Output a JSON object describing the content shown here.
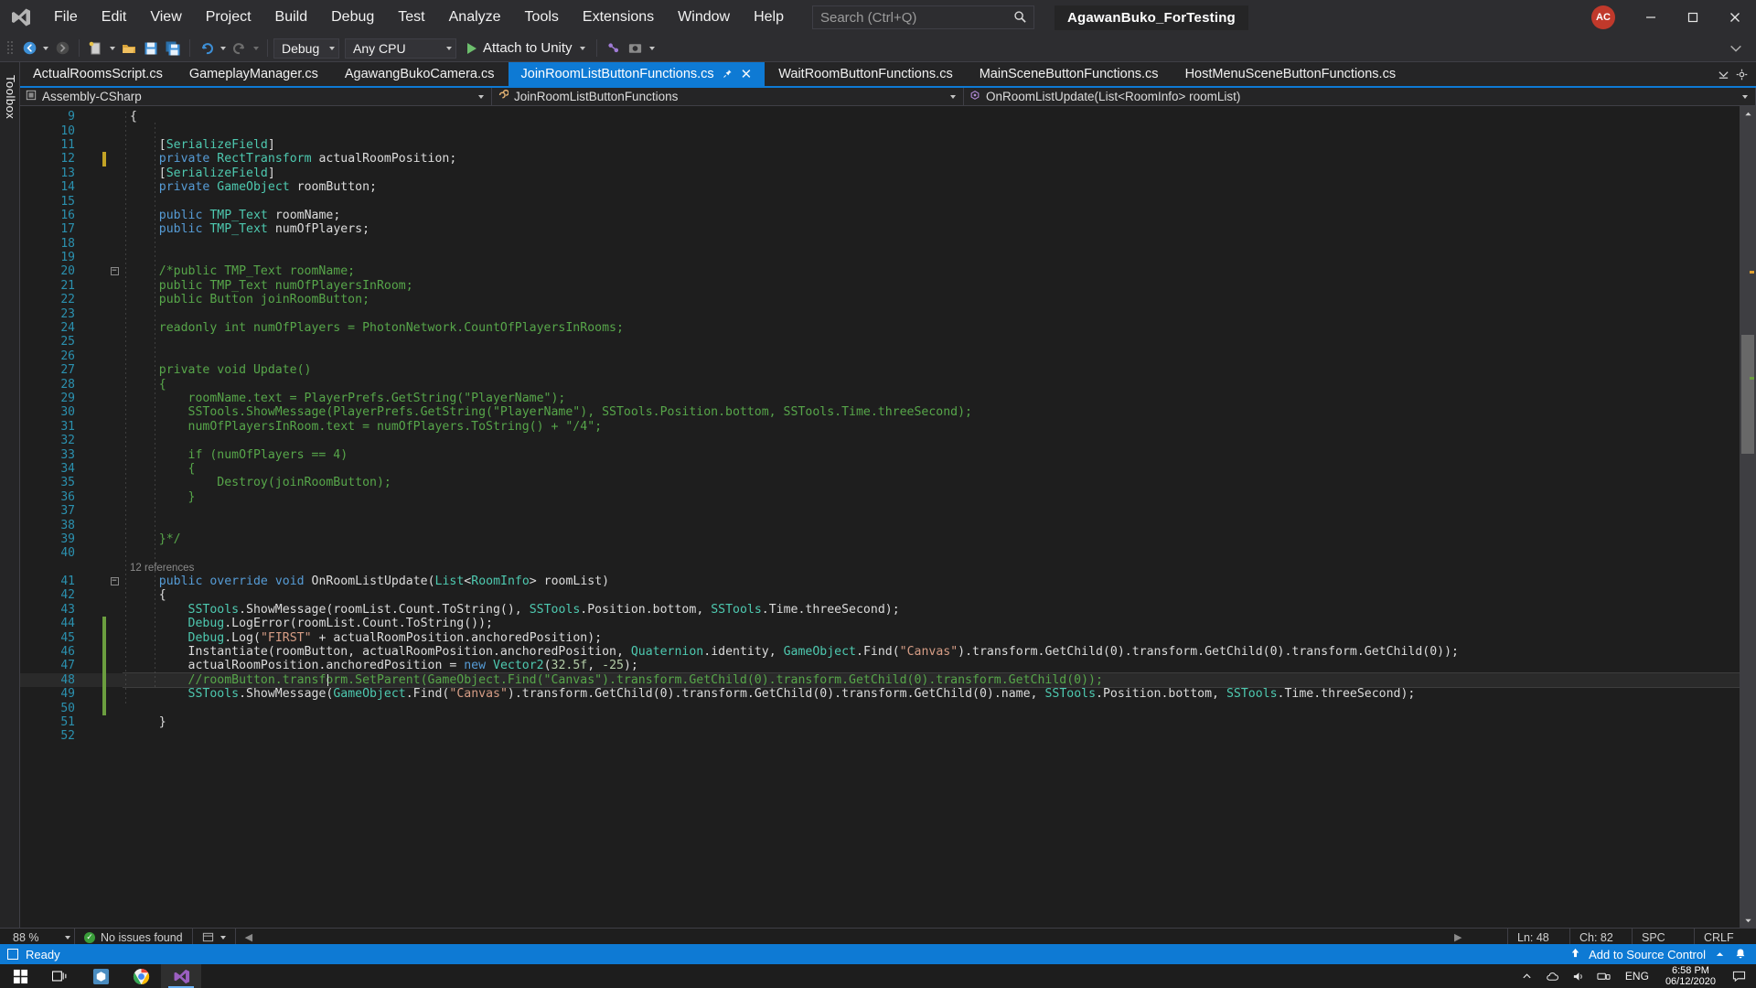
{
  "titlebar": {
    "logo": "visual-studio-logo",
    "menus": [
      "File",
      "Edit",
      "View",
      "Project",
      "Build",
      "Debug",
      "Test",
      "Analyze",
      "Tools",
      "Extensions",
      "Window",
      "Help"
    ],
    "search_placeholder": "Search (Ctrl+Q)",
    "solution_name": "AgawanBuko_ForTesting",
    "user_initials": "AC",
    "minimize": "─",
    "maximize": "☐",
    "close": "✕"
  },
  "toolbar": {
    "nav_back": "back-arrow",
    "nav_forward": "forward-arrow",
    "new_item": "new-item",
    "open_file": "open-file",
    "save": "save",
    "save_all": "save-all",
    "undo": "undo",
    "redo": "redo",
    "config": "Debug",
    "platform": "Any CPU",
    "run_label": "Attach to Unity"
  },
  "toolbox": {
    "label": "Toolbox"
  },
  "tabs": {
    "items": [
      {
        "label": "ActualRoomsScript.cs",
        "active": false
      },
      {
        "label": "GameplayManager.cs",
        "active": false
      },
      {
        "label": "AgawangBukoCamera.cs",
        "active": false
      },
      {
        "label": "JoinRoomListButtonFunctions.cs",
        "active": true
      },
      {
        "label": "WaitRoomButtonFunctions.cs",
        "active": false
      },
      {
        "label": "MainSceneButtonFunctions.cs",
        "active": false
      },
      {
        "label": "HostMenuSceneButtonFunctions.cs",
        "active": false
      }
    ],
    "pin_icon": "pin-icon",
    "close_icon": "close-icon",
    "overflow_icon": "chevron-down-icon",
    "settings_icon": "gear-icon"
  },
  "navbar": {
    "project": "Assembly-CSharp",
    "type": "JoinRoomListButtonFunctions",
    "member": "OnRoomListUpdate(List<RoomInfo> roomList)"
  },
  "editor": {
    "first_line": 9,
    "lines": [
      {
        "n": 9,
        "change": "",
        "fold": "",
        "indent": 1,
        "tokens": [
          [
            "p",
            "{"
          ]
        ]
      },
      {
        "n": 10,
        "change": "",
        "fold": "",
        "indent": 1,
        "tokens": []
      },
      {
        "n": 11,
        "change": "",
        "fold": "",
        "indent": 2,
        "tokens": [
          [
            "p",
            "    ["
          ],
          [
            "atr",
            "SerializeField"
          ],
          [
            "p",
            "]"
          ]
        ]
      },
      {
        "n": 12,
        "change": "yellow",
        "fold": "",
        "indent": 2,
        "tokens": [
          [
            "p",
            "    "
          ],
          [
            "k",
            "private"
          ],
          [
            "p",
            " "
          ],
          [
            "t",
            "RectTransform"
          ],
          [
            "p",
            " actualRoomPosition;"
          ]
        ]
      },
      {
        "n": 13,
        "change": "",
        "fold": "",
        "indent": 2,
        "tokens": [
          [
            "p",
            "    ["
          ],
          [
            "atr",
            "SerializeField"
          ],
          [
            "p",
            "]"
          ]
        ]
      },
      {
        "n": 14,
        "change": "",
        "fold": "",
        "indent": 2,
        "tokens": [
          [
            "p",
            "    "
          ],
          [
            "k",
            "private"
          ],
          [
            "p",
            " "
          ],
          [
            "t",
            "GameObject"
          ],
          [
            "p",
            " roomButton;"
          ]
        ]
      },
      {
        "n": 15,
        "change": "",
        "fold": "",
        "indent": 2,
        "tokens": []
      },
      {
        "n": 16,
        "change": "",
        "fold": "",
        "indent": 2,
        "tokens": [
          [
            "p",
            "    "
          ],
          [
            "k",
            "public"
          ],
          [
            "p",
            " "
          ],
          [
            "t",
            "TMP_Text"
          ],
          [
            "p",
            " roomName;"
          ]
        ]
      },
      {
        "n": 17,
        "change": "",
        "fold": "",
        "indent": 2,
        "tokens": [
          [
            "p",
            "    "
          ],
          [
            "k",
            "public"
          ],
          [
            "p",
            " "
          ],
          [
            "t",
            "TMP_Text"
          ],
          [
            "p",
            " numOfPlayers;"
          ]
        ]
      },
      {
        "n": 18,
        "change": "",
        "fold": "",
        "indent": 2,
        "tokens": []
      },
      {
        "n": 19,
        "change": "",
        "fold": "",
        "indent": 2,
        "tokens": []
      },
      {
        "n": 20,
        "change": "",
        "fold": "minus",
        "indent": 2,
        "tokens": [
          [
            "c",
            "    /*public TMP_Text roomName;"
          ]
        ]
      },
      {
        "n": 21,
        "change": "",
        "fold": "",
        "indent": 2,
        "tokens": [
          [
            "c",
            "    public TMP_Text numOfPlayersInRoom;"
          ]
        ]
      },
      {
        "n": 22,
        "change": "",
        "fold": "",
        "indent": 2,
        "tokens": [
          [
            "c",
            "    public Button joinRoomButton;"
          ]
        ]
      },
      {
        "n": 23,
        "change": "",
        "fold": "",
        "indent": 2,
        "tokens": []
      },
      {
        "n": 24,
        "change": "",
        "fold": "",
        "indent": 2,
        "tokens": [
          [
            "c",
            "    readonly int numOfPlayers = PhotonNetwork.CountOfPlayersInRooms;"
          ]
        ]
      },
      {
        "n": 25,
        "change": "",
        "fold": "",
        "indent": 2,
        "tokens": []
      },
      {
        "n": 26,
        "change": "",
        "fold": "",
        "indent": 2,
        "tokens": []
      },
      {
        "n": 27,
        "change": "",
        "fold": "",
        "indent": 2,
        "tokens": [
          [
            "c",
            "    private void Update()"
          ]
        ]
      },
      {
        "n": 28,
        "change": "",
        "fold": "",
        "indent": 2,
        "tokens": [
          [
            "c",
            "    {"
          ]
        ]
      },
      {
        "n": 29,
        "change": "",
        "fold": "",
        "indent": 3,
        "tokens": [
          [
            "c",
            "        roomName.text = PlayerPrefs.GetString(\"PlayerName\");"
          ]
        ]
      },
      {
        "n": 30,
        "change": "",
        "fold": "",
        "indent": 3,
        "tokens": [
          [
            "c",
            "        SSTools.ShowMessage(PlayerPrefs.GetString(\"PlayerName\"), SSTools.Position.bottom, SSTools.Time.threeSecond);"
          ]
        ]
      },
      {
        "n": 31,
        "change": "",
        "fold": "",
        "indent": 3,
        "tokens": [
          [
            "c",
            "        numOfPlayersInRoom.text = numOfPlayers.ToString() + \"/4\";"
          ]
        ]
      },
      {
        "n": 32,
        "change": "",
        "fold": "",
        "indent": 3,
        "tokens": []
      },
      {
        "n": 33,
        "change": "",
        "fold": "",
        "indent": 3,
        "tokens": [
          [
            "c",
            "        if (numOfPlayers == 4)"
          ]
        ]
      },
      {
        "n": 34,
        "change": "",
        "fold": "",
        "indent": 3,
        "tokens": [
          [
            "c",
            "        {"
          ]
        ]
      },
      {
        "n": 35,
        "change": "",
        "fold": "",
        "indent": 4,
        "tokens": [
          [
            "c",
            "            Destroy(joinRoomButton);"
          ]
        ]
      },
      {
        "n": 36,
        "change": "",
        "fold": "",
        "indent": 3,
        "tokens": [
          [
            "c",
            "        }"
          ]
        ]
      },
      {
        "n": 37,
        "change": "",
        "fold": "",
        "indent": 2,
        "tokens": []
      },
      {
        "n": 38,
        "change": "",
        "fold": "",
        "indent": 2,
        "tokens": []
      },
      {
        "n": 39,
        "change": "",
        "fold": "",
        "indent": 2,
        "tokens": [
          [
            "c",
            "    }*/"
          ]
        ]
      },
      {
        "n": 40,
        "change": "",
        "fold": "",
        "indent": 2,
        "tokens": []
      },
      {
        "n": "",
        "change": "",
        "fold": "",
        "indent": 2,
        "refs": "12 references",
        "tokens": []
      },
      {
        "n": 41,
        "change": "",
        "fold": "minus",
        "indent": 2,
        "tokens": [
          [
            "p",
            "    "
          ],
          [
            "k",
            "public"
          ],
          [
            "p",
            " "
          ],
          [
            "k",
            "override"
          ],
          [
            "p",
            " "
          ],
          [
            "k",
            "void"
          ],
          [
            "p",
            " OnRoomListUpdate("
          ],
          [
            "t",
            "List"
          ],
          [
            "p",
            "<"
          ],
          [
            "t",
            "RoomInfo"
          ],
          [
            "p",
            "> roomList)"
          ]
        ]
      },
      {
        "n": 42,
        "change": "",
        "fold": "",
        "indent": 2,
        "tokens": [
          [
            "p",
            "    {"
          ]
        ]
      },
      {
        "n": 43,
        "change": "",
        "fold": "",
        "indent": 3,
        "tokens": [
          [
            "p",
            "        "
          ],
          [
            "t",
            "SSTools"
          ],
          [
            "p",
            ".ShowMessage(roomList.Count.ToString(), "
          ],
          [
            "t",
            "SSTools"
          ],
          [
            "p",
            ".Position.bottom, "
          ],
          [
            "t",
            "SSTools"
          ],
          [
            "p",
            ".Time.threeSecond);"
          ]
        ]
      },
      {
        "n": 44,
        "change": "green",
        "fold": "",
        "indent": 3,
        "tokens": [
          [
            "p",
            "        "
          ],
          [
            "t",
            "Debug"
          ],
          [
            "p",
            ".LogError(roomList.Count.ToString());"
          ]
        ]
      },
      {
        "n": 45,
        "change": "green",
        "fold": "",
        "indent": 3,
        "tokens": [
          [
            "p",
            "        "
          ],
          [
            "t",
            "Debug"
          ],
          [
            "p",
            ".Log("
          ],
          [
            "s",
            "\"FIRST\""
          ],
          [
            "p",
            " + actualRoomPosition.anchoredPosition);"
          ]
        ]
      },
      {
        "n": 46,
        "change": "green",
        "fold": "",
        "indent": 3,
        "tokens": [
          [
            "p",
            "        Instantiate(roomButton, actualRoomPosition.anchoredPosition, "
          ],
          [
            "t",
            "Quaternion"
          ],
          [
            "p",
            ".identity, "
          ],
          [
            "t",
            "GameObject"
          ],
          [
            "p",
            ".Find("
          ],
          [
            "s",
            "\"Canvas\""
          ],
          [
            "p",
            ").transform.GetChild(0).transform.GetChild(0).transform.GetChild(0));"
          ]
        ]
      },
      {
        "n": 47,
        "change": "green",
        "fold": "",
        "indent": 3,
        "tokens": [
          [
            "p",
            "        actualRoomPosition.anchoredPosition = "
          ],
          [
            "k",
            "new"
          ],
          [
            "p",
            " "
          ],
          [
            "t",
            "Vector2"
          ],
          [
            "p",
            "("
          ],
          [
            "n",
            "32.5f"
          ],
          [
            "p",
            ", "
          ],
          [
            "n",
            "-25"
          ],
          [
            "p",
            ");"
          ]
        ]
      },
      {
        "n": 48,
        "change": "green",
        "fold": "",
        "indent": 3,
        "highlight": true,
        "caret_after": 30,
        "tokens": [
          [
            "c",
            "        //roomButton.transform.SetParent(GameObject.Find(\"Canvas\").transform.GetChild(0).transform.GetChild(0).transform.GetChild(0));"
          ]
        ]
      },
      {
        "n": 49,
        "change": "green",
        "fold": "",
        "indent": 3,
        "tokens": [
          [
            "p",
            "        "
          ],
          [
            "t",
            "SSTools"
          ],
          [
            "p",
            ".ShowMessage("
          ],
          [
            "t",
            "GameObject"
          ],
          [
            "p",
            ".Find("
          ],
          [
            "s",
            "\"Canvas\""
          ],
          [
            "p",
            ").transform.GetChild(0).transform.GetChild(0).transform.GetChild(0).name, "
          ],
          [
            "t",
            "SSTools"
          ],
          [
            "p",
            ".Position.bottom, "
          ],
          [
            "t",
            "SSTools"
          ],
          [
            "p",
            ".Time.threeSecond);"
          ]
        ]
      },
      {
        "n": 50,
        "change": "green",
        "fold": "",
        "indent": 3,
        "tokens": []
      },
      {
        "n": 51,
        "change": "",
        "fold": "",
        "indent": 2,
        "tokens": [
          [
            "p",
            "    }"
          ]
        ]
      },
      {
        "n": 52,
        "change": "",
        "fold": "",
        "indent": 2,
        "tokens": []
      }
    ]
  },
  "editor_status": {
    "zoom": "88 %",
    "issues": "No issues found",
    "issues_icon": "check-icon",
    "scope_icon": "scope-icon",
    "line": "Ln: 48",
    "col": "Ch: 82",
    "spaces": "SPC",
    "eol": "CRLF"
  },
  "statusbar": {
    "ready": "Ready",
    "source_control": "Add to Source Control",
    "up_icon": "up-arrow-icon",
    "bell_icon": "bell-icon",
    "ready_icon": "window-icon"
  },
  "taskbar": {
    "start": "windows-start-icon",
    "taskview": "task-view-icon",
    "apps": [
      {
        "name": "unity-app",
        "active": false
      },
      {
        "name": "chrome-app",
        "active": false
      },
      {
        "name": "visual-studio-app",
        "active": true
      }
    ],
    "tray_chevron": "chevron-up-icon",
    "tray_onedrive": "cloud-icon",
    "tray_volume": "volume-icon",
    "tray_network": "network-icon",
    "language": "ENG",
    "time": "6:58 PM",
    "date": "06/12/2020",
    "notifications": "notification-icon"
  },
  "colors": {
    "accent": "#0e7ad4",
    "chrome": "#2d2d30",
    "editor_bg": "#1e1e1e",
    "keyword": "#569cd6",
    "type": "#4ec9b0",
    "string": "#d69d85",
    "comment": "#57a64a",
    "number": "#b5cea8"
  }
}
